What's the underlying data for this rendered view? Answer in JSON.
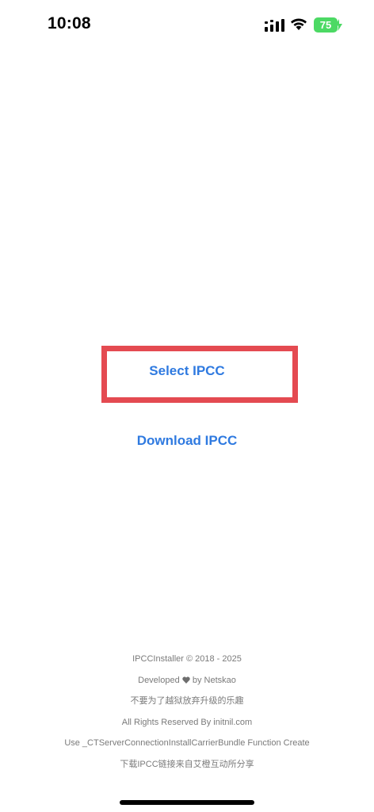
{
  "status_bar": {
    "time": "10:08",
    "battery_level": "75",
    "battery_color": "#4cd964",
    "icons": [
      "signal-icon",
      "wifi-icon",
      "battery-icon",
      "charging-bolt-icon"
    ]
  },
  "actions": {
    "select_label": "Select IPCC",
    "download_label": "Download IPCC",
    "accent_color": "#2f7ae0",
    "highlight_color": "#e44a51"
  },
  "footer": {
    "copyright": "IPCCInstaller © 2018 - 2025",
    "developed_prefix": "Developed",
    "developed_suffix": "by Netskao",
    "slogan": "不要为了越狱放弃升级的乐趣",
    "rights": "All Rights Reserved By initnil.com",
    "function_note": "Use _CTServerConnectionInstallCarrierBundle Function Create",
    "download_source": "下载IPCC链接来自艾橙互动所分享"
  }
}
